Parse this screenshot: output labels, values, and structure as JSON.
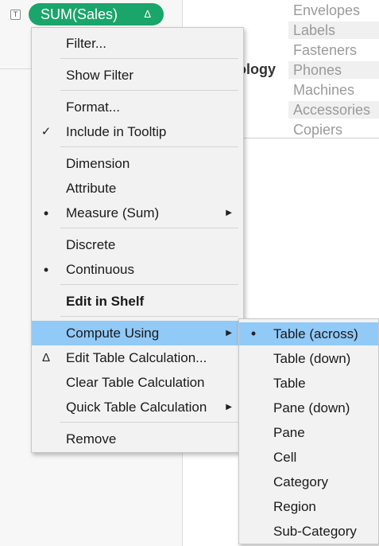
{
  "marks_icon": "T",
  "pill": {
    "label": "SUM(Sales)",
    "delta": "Δ",
    "color": "#1aa56b"
  },
  "background": {
    "header_label": "ology",
    "categories": [
      "Envelopes",
      "Labels",
      "Fasteners",
      "Phones",
      "Machines",
      "Accessories",
      "Copiers"
    ]
  },
  "menu": {
    "filter": "Filter...",
    "show_filter": "Show Filter",
    "format": "Format...",
    "include_in_tooltip": "Include in Tooltip",
    "dimension": "Dimension",
    "attribute": "Attribute",
    "measure": "Measure (Sum)",
    "discrete": "Discrete",
    "continuous": "Continuous",
    "edit_in_shelf": "Edit in Shelf",
    "compute_using": "Compute Using",
    "edit_table_calc": "Edit Table Calculation...",
    "clear_table_calc": "Clear Table Calculation",
    "quick_table_calc": "Quick Table Calculation",
    "remove": "Remove",
    "check_glyph": "✓",
    "dot_glyph": "•",
    "delta_glyph": "Δ",
    "arrow_glyph": "▶"
  },
  "submenu": {
    "items": [
      "Table (across)",
      "Table (down)",
      "Table",
      "Pane (down)",
      "Pane",
      "Cell",
      "Category",
      "Region",
      "Sub-Category"
    ],
    "selected_index": 0
  },
  "colors": {
    "highlight": "#91c9f7",
    "menu_bg": "#f2f2f2"
  }
}
